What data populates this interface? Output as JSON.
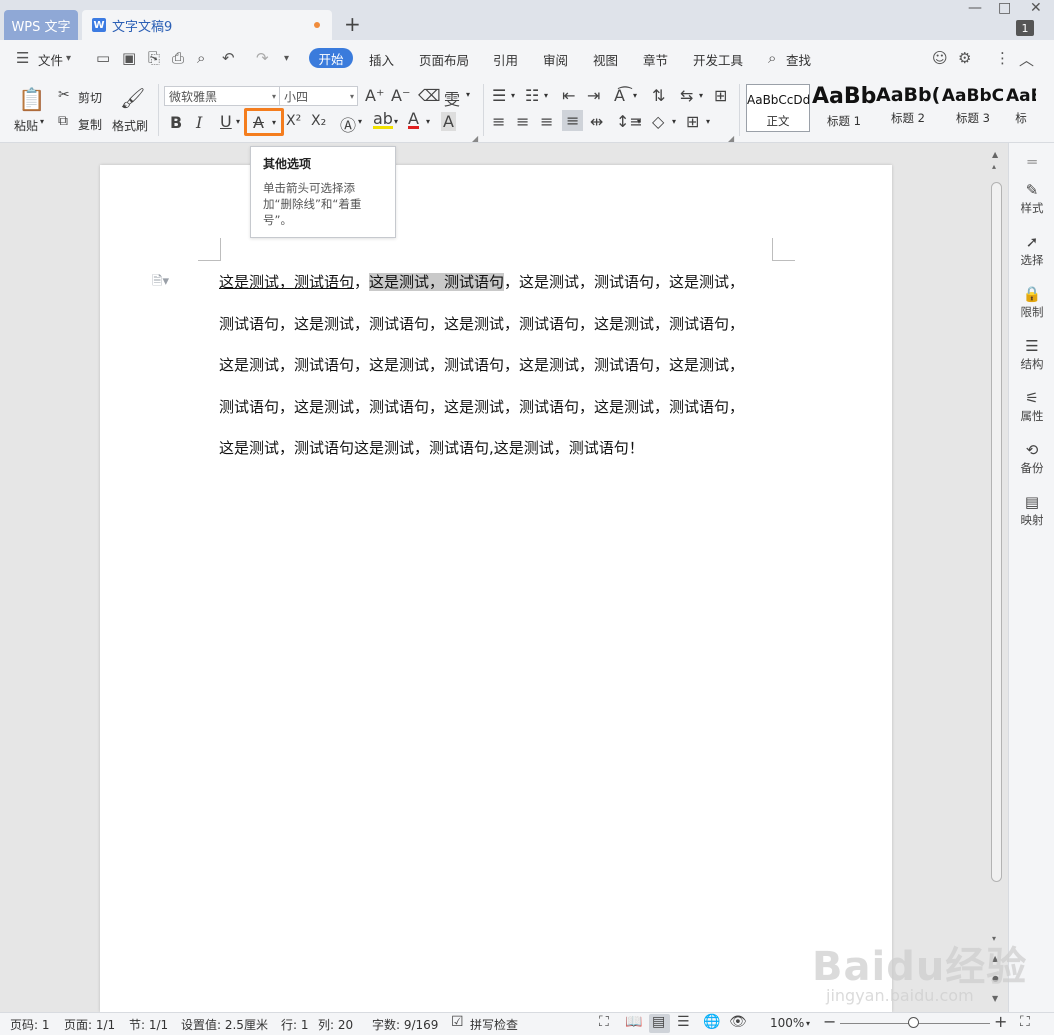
{
  "tabs": {
    "home": "WPS 文字",
    "doc": "文字文稿9",
    "doc_icon": "W",
    "add": "+"
  },
  "window": {
    "minimize": "—",
    "maximize": "□",
    "close": "✕",
    "badge": "1"
  },
  "menu": {
    "file": "文件",
    "items": [
      "开始",
      "插入",
      "页面布局",
      "引用",
      "审阅",
      "视图",
      "章节",
      "开发工具"
    ],
    "search": "查找"
  },
  "ribbon": {
    "paste": "粘贴",
    "cut": "剪切",
    "copy": "复制",
    "format_painter": "格式刷",
    "font_name": "微软雅黑",
    "font_size": "小四",
    "bold": "B",
    "italic": "I",
    "underline": "U",
    "strike": "A",
    "superscript": "X²",
    "subscript": "X₂",
    "styles": [
      {
        "preview": "AaBbCcDd",
        "label": "正文"
      },
      {
        "preview": "AaBb",
        "label": "标题 1"
      },
      {
        "preview": "AaBb(",
        "label": "标题 2"
      },
      {
        "preview": "AaBbC",
        "label": "标题 3"
      },
      {
        "preview": "AaB",
        "label": "标"
      }
    ]
  },
  "tooltip": {
    "title": "其他选项",
    "body": "单击箭头可选择添加“删除线”和“着重号”。"
  },
  "document": {
    "line1_underlined": "这是测试，测试语句",
    "line1_sep": "，",
    "line1_highlight": "这是测试，测试语句",
    "line1_rest": "，这是测试，测试语句，这是测试，",
    "lines": [
      "测试语句，这是测试，测试语句，这是测试，测试语句，这是测试，测试语句，",
      "这是测试，测试语句，这是测试，测试语句，这是测试，测试语句，这是测试，",
      "测试语句，这是测试，测试语句，这是测试，测试语句，这是测试，测试语句，",
      "这是测试，测试语句这是测试，测试语句,这是测试，测试语句！"
    ]
  },
  "right_panel": [
    {
      "icon": "pen-icon",
      "label": "样式"
    },
    {
      "icon": "cursor-icon",
      "label": "选择"
    },
    {
      "icon": "lock-icon",
      "label": "限制"
    },
    {
      "icon": "structure-icon",
      "label": "结构"
    },
    {
      "icon": "sliders-icon",
      "label": "属性"
    },
    {
      "icon": "history-icon",
      "label": "备份"
    },
    {
      "icon": "mapping-icon",
      "label": "映射"
    }
  ],
  "status": {
    "page_no": "页码: 1",
    "pages": "页面: 1/1",
    "section": "节: 1/1",
    "setting": "设置值: 2.5厘米",
    "row": "行: 1",
    "col": "列: 20",
    "words": "字数: 9/169",
    "spell": "拼写检查",
    "zoom": "100%"
  },
  "watermark": {
    "main": "Baidu经验",
    "sub": "jingyan.baidu.com"
  },
  "colors": {
    "accent": "#3a7bdc",
    "highlight_box": "#f47d1e"
  }
}
